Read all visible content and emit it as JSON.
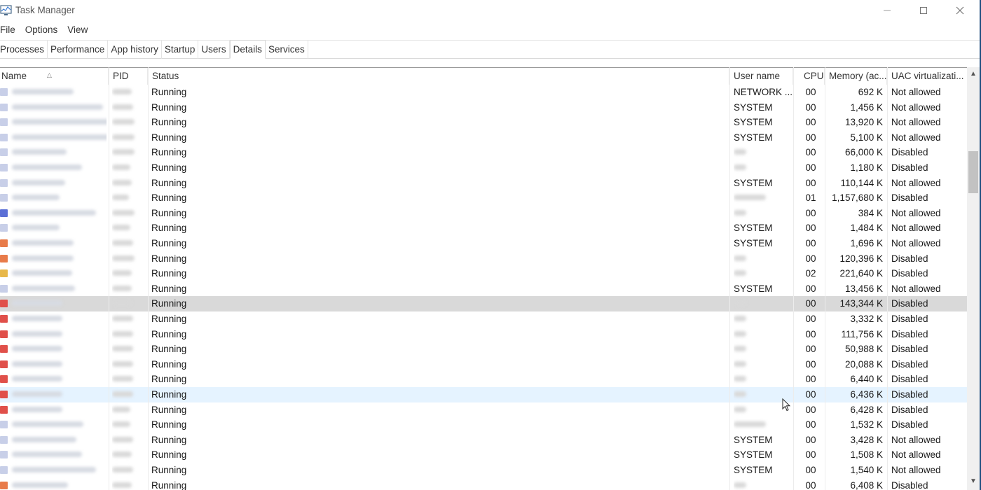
{
  "window": {
    "title": "Task Manager"
  },
  "menu": [
    "File",
    "Options",
    "View"
  ],
  "tabs": [
    "Processes",
    "Performance",
    "App history",
    "Startup",
    "Users",
    "Details",
    "Services"
  ],
  "active_tab": "Details",
  "columns": {
    "name": "Name",
    "pid": "PID",
    "status": "Status",
    "user": "User name",
    "cpu": "CPU",
    "mem": "Memory (ac...",
    "uac": "UAC virtualizati..."
  },
  "colors": {
    "selected_row": "#d9d9d9",
    "hover_row": "#e5f3ff",
    "window_border": "#1f4f80"
  },
  "rows": [
    {
      "status": "Running",
      "user": "NETWORK ...",
      "cpu": "00",
      "mem": "692 K",
      "uac": "Not allowed",
      "icon": "#c8cfe8"
    },
    {
      "status": "Running",
      "user": "SYSTEM",
      "cpu": "00",
      "mem": "1,456 K",
      "uac": "Not allowed",
      "icon": "#c8cfe8"
    },
    {
      "status": "Running",
      "user": "SYSTEM",
      "cpu": "00",
      "mem": "13,920 K",
      "uac": "Not allowed",
      "icon": "#c8cfe8"
    },
    {
      "status": "Running",
      "user": "SYSTEM",
      "cpu": "00",
      "mem": "5,100 K",
      "uac": "Not allowed",
      "icon": "#c8cfe8"
    },
    {
      "status": "Running",
      "user": "",
      "cpu": "00",
      "mem": "66,000 K",
      "uac": "Disabled",
      "icon": "#c8cfe8"
    },
    {
      "status": "Running",
      "user": "",
      "cpu": "00",
      "mem": "1,180 K",
      "uac": "Disabled",
      "icon": "#c8cfe8"
    },
    {
      "status": "Running",
      "user": "SYSTEM",
      "cpu": "00",
      "mem": "110,144 K",
      "uac": "Not allowed",
      "icon": "#c8cfe8"
    },
    {
      "status": "Running",
      "user": "",
      "cpu": "01",
      "mem": "1,157,680 K",
      "uac": "Disabled",
      "icon": "#c8cfe8"
    },
    {
      "status": "Running",
      "user": "",
      "cpu": "00",
      "mem": "384 K",
      "uac": "Not allowed",
      "icon": "#5b6fd6"
    },
    {
      "status": "Running",
      "user": "SYSTEM",
      "cpu": "00",
      "mem": "1,484 K",
      "uac": "Not allowed",
      "icon": "#c8cfe8"
    },
    {
      "status": "Running",
      "user": "SYSTEM",
      "cpu": "00",
      "mem": "1,696 K",
      "uac": "Not allowed",
      "icon": "#e87b4a"
    },
    {
      "status": "Running",
      "user": "",
      "cpu": "00",
      "mem": "120,396 K",
      "uac": "Disabled",
      "icon": "#e87b4a"
    },
    {
      "status": "Running",
      "user": "",
      "cpu": "02",
      "mem": "221,640 K",
      "uac": "Disabled",
      "icon": "#e8b84a"
    },
    {
      "status": "Running",
      "user": "SYSTEM",
      "cpu": "00",
      "mem": "13,456 K",
      "uac": "Not allowed",
      "icon": "#c8cfe8"
    },
    {
      "status": "Running",
      "user": "",
      "cpu": "00",
      "mem": "143,344 K",
      "uac": "Disabled",
      "icon": "#e0504a",
      "state": "selected"
    },
    {
      "status": "Running",
      "user": "",
      "cpu": "00",
      "mem": "3,332 K",
      "uac": "Disabled",
      "icon": "#e0504a"
    },
    {
      "status": "Running",
      "user": "",
      "cpu": "00",
      "mem": "111,756 K",
      "uac": "Disabled",
      "icon": "#e0504a"
    },
    {
      "status": "Running",
      "user": "",
      "cpu": "00",
      "mem": "50,988 K",
      "uac": "Disabled",
      "icon": "#e0504a"
    },
    {
      "status": "Running",
      "user": "",
      "cpu": "00",
      "mem": "20,088 K",
      "uac": "Disabled",
      "icon": "#e0504a"
    },
    {
      "status": "Running",
      "user": "",
      "cpu": "00",
      "mem": "6,440 K",
      "uac": "Disabled",
      "icon": "#e0504a"
    },
    {
      "status": "Running",
      "user": "",
      "cpu": "00",
      "mem": "6,436 K",
      "uac": "Disabled",
      "icon": "#e0504a",
      "state": "hover"
    },
    {
      "status": "Running",
      "user": "",
      "cpu": "00",
      "mem": "6,428 K",
      "uac": "Disabled",
      "icon": "#e0504a"
    },
    {
      "status": "Running",
      "user": "",
      "cpu": "00",
      "mem": "1,532 K",
      "uac": "Disabled",
      "icon": "#c8cfe8"
    },
    {
      "status": "Running",
      "user": "SYSTEM",
      "cpu": "00",
      "mem": "3,428 K",
      "uac": "Not allowed",
      "icon": "#c8cfe8"
    },
    {
      "status": "Running",
      "user": "SYSTEM",
      "cpu": "00",
      "mem": "1,508 K",
      "uac": "Not allowed",
      "icon": "#c8cfe8"
    },
    {
      "status": "Running",
      "user": "SYSTEM",
      "cpu": "00",
      "mem": "1,540 K",
      "uac": "Not allowed",
      "icon": "#c8cfe8"
    },
    {
      "status": "Running",
      "user": "",
      "cpu": "00",
      "mem": "6,408 K",
      "uac": "Disabled",
      "icon": "#e87b4a"
    }
  ]
}
